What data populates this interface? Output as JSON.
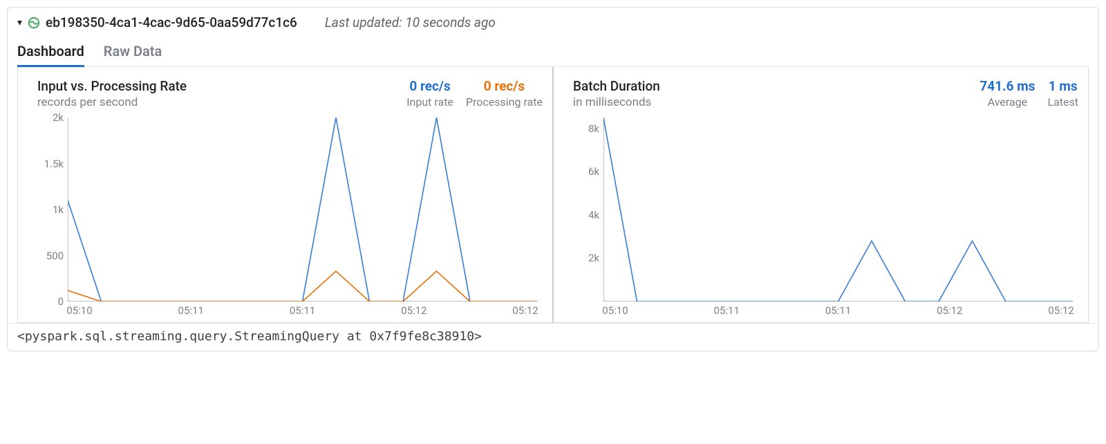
{
  "header": {
    "query_id": "eb198350-4ca1-4cac-9d65-0aa59d77c1c6",
    "status": "running",
    "last_updated_label": "Last updated: 10 seconds ago"
  },
  "tabs": [
    {
      "label": "Dashboard",
      "active": true
    },
    {
      "label": "Raw Data",
      "active": false
    }
  ],
  "charts": {
    "rate": {
      "title": "Input vs. Processing Rate",
      "subtitle": "records per second",
      "metrics": [
        {
          "value": "0 rec/s",
          "label": "Input rate",
          "color": "blue"
        },
        {
          "value": "0 rec/s",
          "label": "Processing rate",
          "color": "orange"
        }
      ]
    },
    "batch": {
      "title": "Batch Duration",
      "subtitle": "in milliseconds",
      "metrics": [
        {
          "value": "741.6 ms",
          "label": "Average",
          "color": "blue"
        },
        {
          "value": "1 ms",
          "label": "Latest",
          "color": "blue"
        }
      ]
    }
  },
  "chart_data": [
    {
      "id": "rate",
      "type": "line",
      "title": "Input vs. Processing Rate",
      "xlabel": "",
      "ylabel": "records per second",
      "ylim": [
        0,
        2000
      ],
      "x_tick_labels": [
        "05:10",
        "05:11",
        "05:11",
        "05:12",
        "05:12"
      ],
      "x": [
        0,
        1,
        2,
        3,
        4,
        5,
        6,
        7,
        8,
        9,
        10,
        11,
        12,
        13,
        14
      ],
      "series": [
        {
          "name": "Input rate",
          "color": "#3a7bd5",
          "values": [
            1100,
            0,
            0,
            0,
            0,
            0,
            0,
            0,
            2000,
            0,
            0,
            2000,
            0,
            0,
            0
          ]
        },
        {
          "name": "Processing rate",
          "color": "#e8710a",
          "values": [
            120,
            0,
            0,
            0,
            0,
            0,
            0,
            0,
            330,
            0,
            0,
            330,
            0,
            0,
            0
          ]
        }
      ],
      "y_ticks": [
        0,
        500,
        1000,
        1500,
        2000
      ]
    },
    {
      "id": "batch",
      "type": "line",
      "title": "Batch Duration",
      "xlabel": "",
      "ylabel": "milliseconds",
      "ylim": [
        0,
        8500
      ],
      "x_tick_labels": [
        "05:10",
        "05:11",
        "05:11",
        "05:12",
        "05:12"
      ],
      "x": [
        0,
        1,
        2,
        3,
        4,
        5,
        6,
        7,
        8,
        9,
        10,
        11,
        12,
        13,
        14
      ],
      "series": [
        {
          "name": "Batch duration",
          "color": "#3a7bd5",
          "values": [
            8500,
            0,
            0,
            0,
            0,
            0,
            0,
            0,
            2800,
            0,
            0,
            2800,
            0,
            0,
            0
          ]
        }
      ],
      "y_ticks": [
        2000,
        4000,
        6000,
        8000
      ]
    }
  ],
  "footer": {
    "repr": "<pyspark.sql.streaming.query.StreamingQuery at 0x7f9fe8c38910>"
  }
}
